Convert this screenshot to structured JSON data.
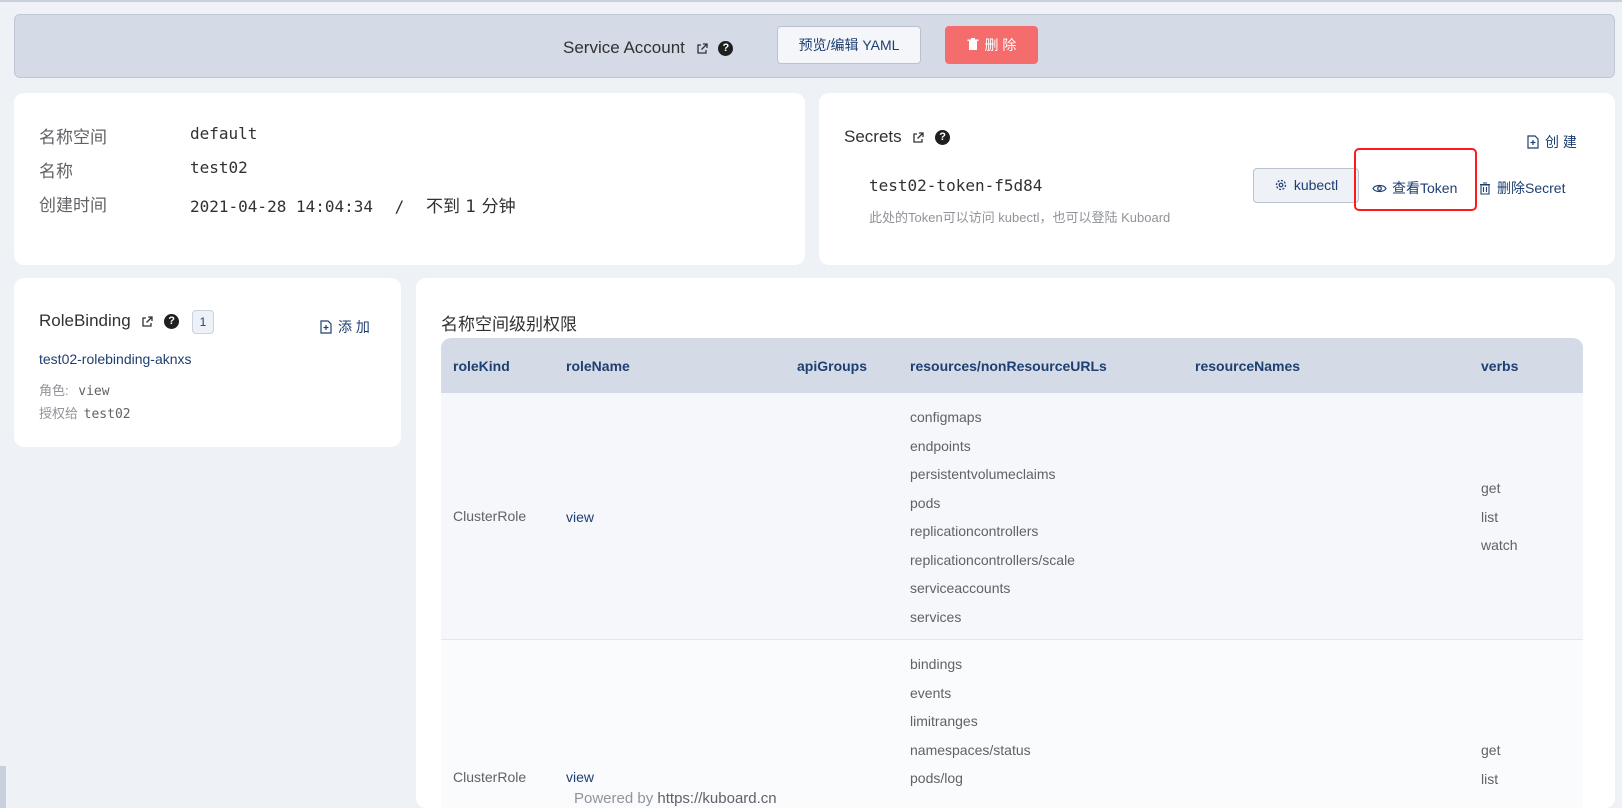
{
  "header": {
    "title": "Service Account",
    "yaml_button": "预览/编辑 YAML",
    "delete_button": "删 除"
  },
  "info": {
    "namespace_label": "名称空间",
    "namespace_value": "default",
    "name_label": "名称",
    "name_value": "test02",
    "created_label": "创建时间",
    "created_value": "2021-04-28 14:04:34",
    "created_sep": "/",
    "created_relative": "不到 1 分钟"
  },
  "secrets": {
    "title": "Secrets",
    "create_button": "创 建",
    "items": [
      {
        "name": "test02-token-f5d84",
        "description": "此处的Token可以访问 kubectl，也可以登陆 Kuboard",
        "kubectl_button": "kubectl",
        "view_token_button": "查看Token",
        "delete_secret_button": "删除Secret"
      }
    ]
  },
  "rolebinding": {
    "title": "RoleBinding",
    "count": "1",
    "add_button": "添 加",
    "items": [
      {
        "name": "test02-rolebinding-aknxs",
        "role_label": "角色:",
        "role_value": "view",
        "grant_label": "授权给",
        "grant_value": "test02"
      }
    ]
  },
  "permissions": {
    "title": "名称空间级别权限",
    "columns": [
      "roleKind",
      "roleName",
      "apiGroups",
      "resources/nonResourceURLs",
      "resourceNames",
      "verbs"
    ],
    "rows": [
      {
        "roleKind": "ClusterRole",
        "roleName": "view",
        "resources": [
          "configmaps",
          "endpoints",
          "persistentvolumeclaims",
          "pods",
          "replicationcontrollers",
          "replicationcontrollers/scale",
          "serviceaccounts",
          "services"
        ],
        "verbs": [
          "get",
          "list",
          "watch"
        ]
      },
      {
        "roleKind": "ClusterRole",
        "roleName": "view",
        "resources": [
          "bindings",
          "events",
          "limitranges",
          "namespaces/status",
          "pods/log"
        ],
        "verbs": [
          "get",
          "list"
        ]
      }
    ]
  },
  "footer": {
    "powered": "Powered by",
    "url": "https://kuboard.cn"
  },
  "colors": {
    "accent": "#1d3f72",
    "danger": "#f56c6c",
    "highlight": "#ff1a1a",
    "header_bg": "#d5dbe6"
  }
}
